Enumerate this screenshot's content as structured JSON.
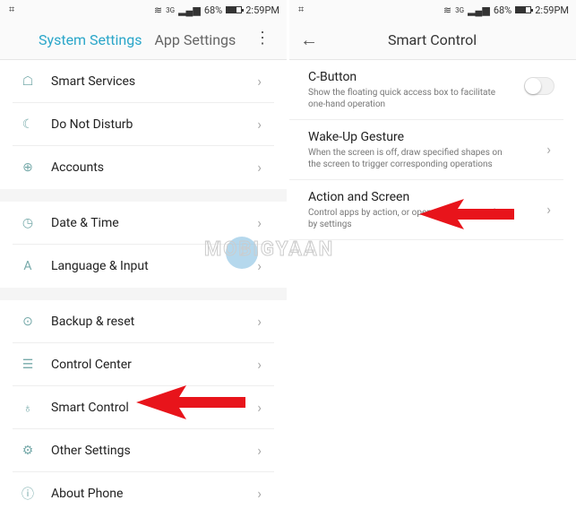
{
  "status": {
    "battery": "68%",
    "time": "2:59PM",
    "network": "3G"
  },
  "left": {
    "tabs": [
      {
        "label": "System Settings",
        "active": true
      },
      {
        "label": "App Settings",
        "active": false
      }
    ],
    "groups": [
      [
        {
          "label": "Smart Services",
          "icon": "android-icon"
        },
        {
          "label": "Do Not Disturb",
          "icon": "moon-icon"
        },
        {
          "label": "Accounts",
          "icon": "plus-circle-icon"
        }
      ],
      [
        {
          "label": "Date & Time",
          "icon": "clock-icon"
        },
        {
          "label": "Language & Input",
          "icon": "language-icon"
        }
      ],
      [
        {
          "label": "Backup & reset",
          "icon": "backup-icon"
        },
        {
          "label": "Control Center",
          "icon": "toggles-icon"
        },
        {
          "label": "Smart Control",
          "icon": "bulb-icon"
        },
        {
          "label": "Other Settings",
          "icon": "gear-icon"
        },
        {
          "label": "About Phone",
          "icon": "info-icon"
        }
      ]
    ]
  },
  "right": {
    "title": "Smart Control",
    "items": [
      {
        "title": "C-Button",
        "desc": "Show the floating quick access box to facilitate one-hand operation",
        "control": "toggle",
        "on": false
      },
      {
        "title": "Wake-Up Gesture",
        "desc": "When the screen is off, draw specified shapes on the screen to trigger corresponding operations",
        "control": "chevron"
      },
      {
        "title": "Action and Screen",
        "desc": "Control apps by action, or open the screen mode by settings",
        "control": "chevron"
      }
    ]
  },
  "watermark": "MOBIGYAAN",
  "colors": {
    "accent": "#2aa6c9",
    "arrow": "#e8141b"
  }
}
